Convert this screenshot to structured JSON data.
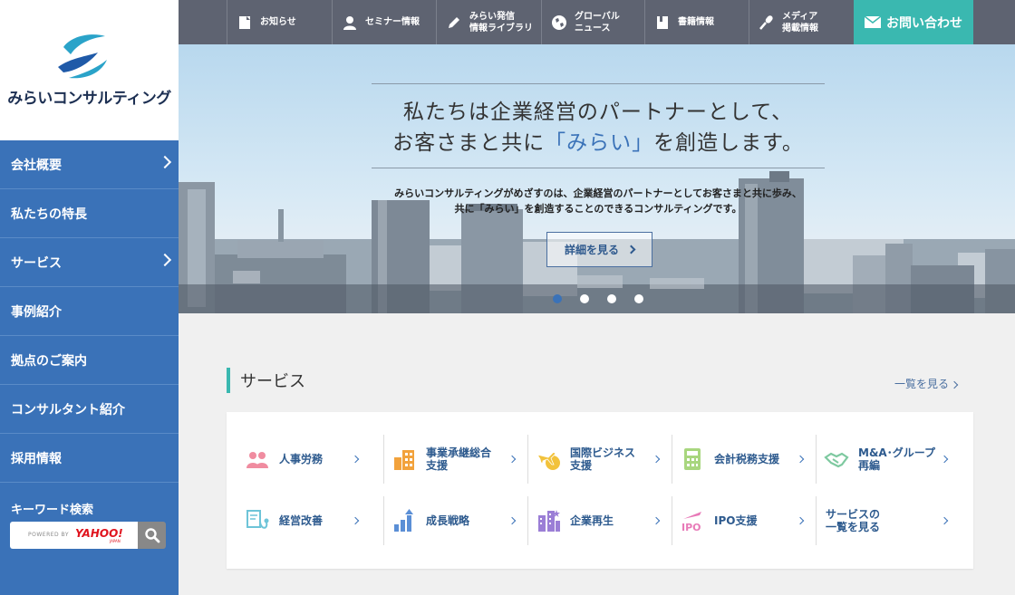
{
  "brand": {
    "name": "みらいコンサルティング",
    "colors": {
      "primary": "#3a72b8",
      "accent": "#3ab8b0",
      "topnav": "#5e6371"
    }
  },
  "sidebar": {
    "items": [
      {
        "label": "会社概要",
        "has_arrow": true
      },
      {
        "label": "私たちの特長",
        "has_arrow": false
      },
      {
        "label": "サービス",
        "has_arrow": true
      },
      {
        "label": "事例紹介",
        "has_arrow": false
      },
      {
        "label": "拠点のご案内",
        "has_arrow": false
      },
      {
        "label": "コンサルタント紹介",
        "has_arrow": false
      },
      {
        "label": "採用情報",
        "has_arrow": false
      }
    ],
    "keyword_title": "キーワード検索",
    "search": {
      "powered_by": "POWERED BY",
      "provider": "YAHOO!",
      "provider_sub": "JAPAN",
      "icon": "search-icon"
    }
  },
  "topnav": {
    "items": [
      {
        "label1": "お知らせ",
        "label2": "",
        "icon": "document-icon"
      },
      {
        "label1": "セミナー情報",
        "label2": "",
        "icon": "person-icon"
      },
      {
        "label1": "みらい発信",
        "label2": "情報ライブラリ",
        "icon": "pencil-icon"
      },
      {
        "label1": "グローバル",
        "label2": "ニュース",
        "icon": "globe-icon"
      },
      {
        "label1": "書籍情報",
        "label2": "",
        "icon": "book-icon"
      },
      {
        "label1": "メディア",
        "label2": "掲載情報",
        "icon": "microphone-icon"
      }
    ],
    "contact": {
      "label": "お問い合わせ",
      "icon": "envelope-icon"
    }
  },
  "hero": {
    "line1": "私たちは企業経営のパートナーとして、",
    "line2_pre": "お客さまと共に",
    "line2_hl": "「みらい」",
    "line2_post": "を創造します。",
    "sub1": "みらいコンサルティングがめざすのは、企業経営のパートナーとしてお客さまと共に歩み、",
    "sub2": "共に「みらい」を創造することのできるコンサルティングです。",
    "button": "詳細を見る",
    "slide_count": 4,
    "active_slide": 1
  },
  "services": {
    "title": "サービス",
    "more": "一覧を見る",
    "items": [
      {
        "l1": "人事労務",
        "l2": "",
        "icon": "people-icon",
        "color": "#f08ca0"
      },
      {
        "l1": "事業承継総合",
        "l2": "支援",
        "icon": "building-icon",
        "color": "#f2a23c"
      },
      {
        "l1": "国際ビジネス",
        "l2": "支援",
        "icon": "airplane-globe-icon",
        "color": "#f2c23c"
      },
      {
        "l1": "会計税務支援",
        "l2": "",
        "icon": "calculator-icon",
        "color": "#a8d67e"
      },
      {
        "l1": "M&A･グループ",
        "l2": "再編",
        "icon": "handshake-icon",
        "color": "#7ec9a0"
      },
      {
        "l1": "経営改善",
        "l2": "",
        "icon": "stethoscope-icon",
        "color": "#6ec4d8"
      },
      {
        "l1": "成長戦略",
        "l2": "",
        "icon": "bar-chart-icon",
        "color": "#5b8fd6"
      },
      {
        "l1": "企業再生",
        "l2": "",
        "icon": "city-icon",
        "color": "#9b7ed6"
      },
      {
        "l1": "IPO支援",
        "l2": "",
        "icon": "ipo-icon",
        "color": "#e87ab8"
      },
      {
        "l1": "サービスの",
        "l2": "一覧を見る",
        "icon": "",
        "color": ""
      }
    ]
  }
}
